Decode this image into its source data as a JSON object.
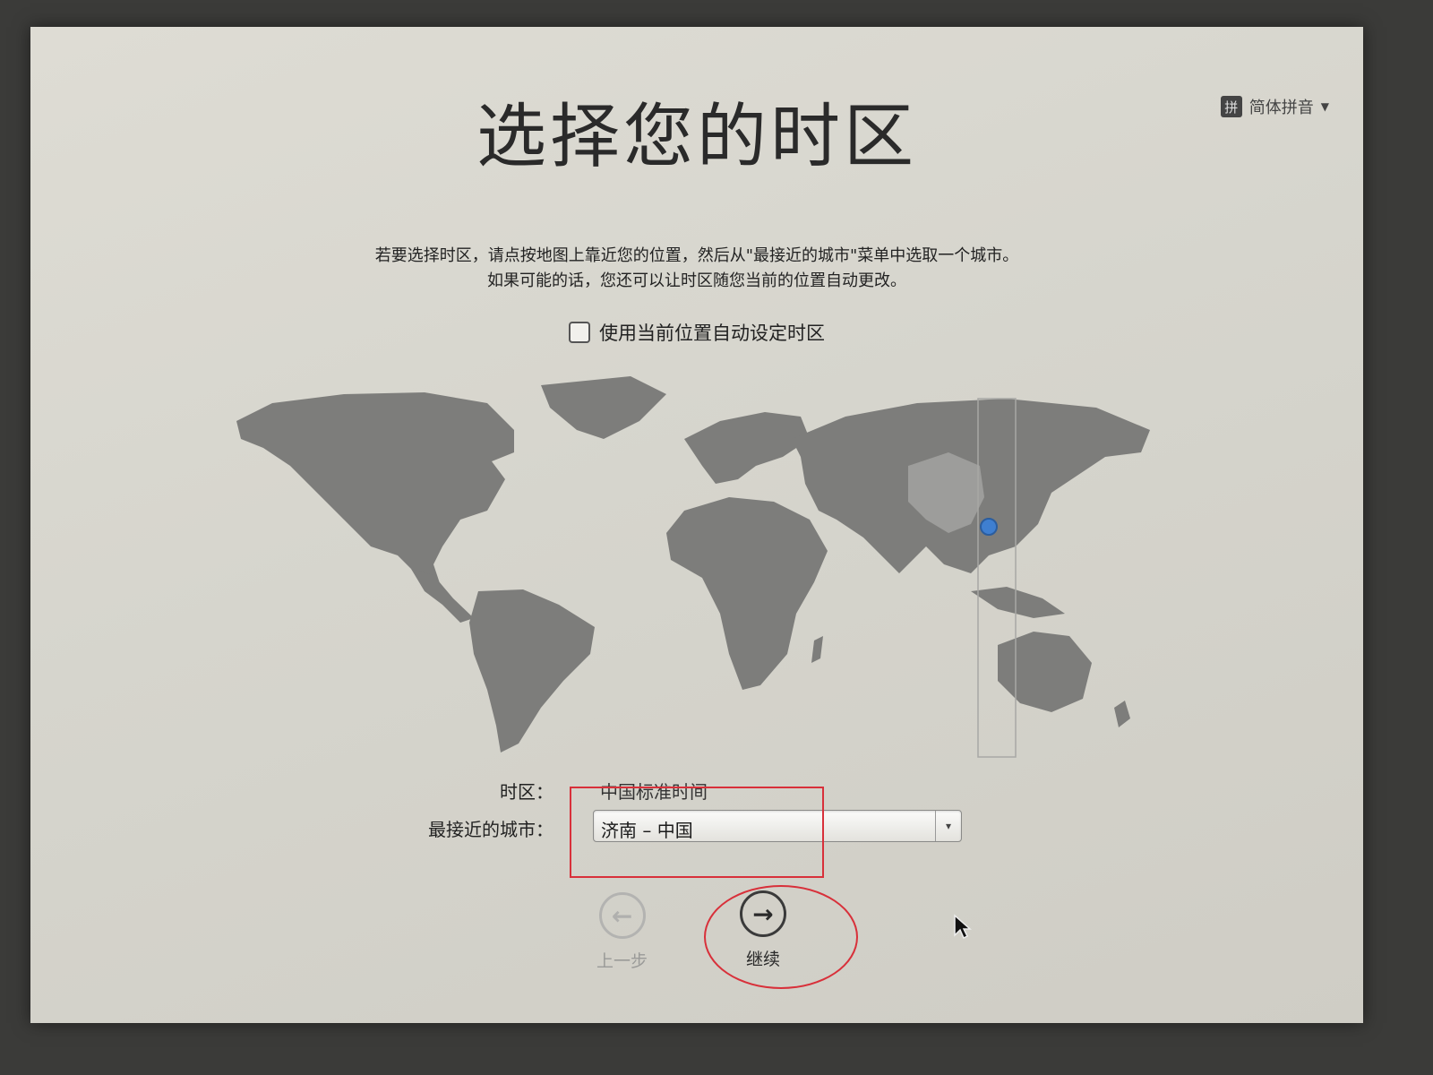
{
  "title": "选择您的时区",
  "input_menu": {
    "icon_text": "拼",
    "label": "简体拼音",
    "arrow": "▼"
  },
  "instructions": {
    "line1": "若要选择时区，请点按地图上靠近您的位置，然后从\"最接近的城市\"菜单中选取一个城市。",
    "line2": "如果可能的话，您还可以让时区随您当前的位置自动更改。"
  },
  "auto_timezone": {
    "label": "使用当前位置自动设定时区",
    "checked": false
  },
  "form": {
    "timezone_label": "时区：",
    "timezone_value": "中国标准时间",
    "city_label": "最接近的城市：",
    "city_value": "济南 – 中国",
    "dropdown_arrow": "▾"
  },
  "nav": {
    "back_label": "上一步",
    "back_arrow": "←",
    "next_label": "继续",
    "next_arrow": "→"
  },
  "colors": {
    "land": "#7d7d7b",
    "land_highlight": "#9d9d9b",
    "pin": "#3f7fd0",
    "annotation": "#d8303a"
  }
}
